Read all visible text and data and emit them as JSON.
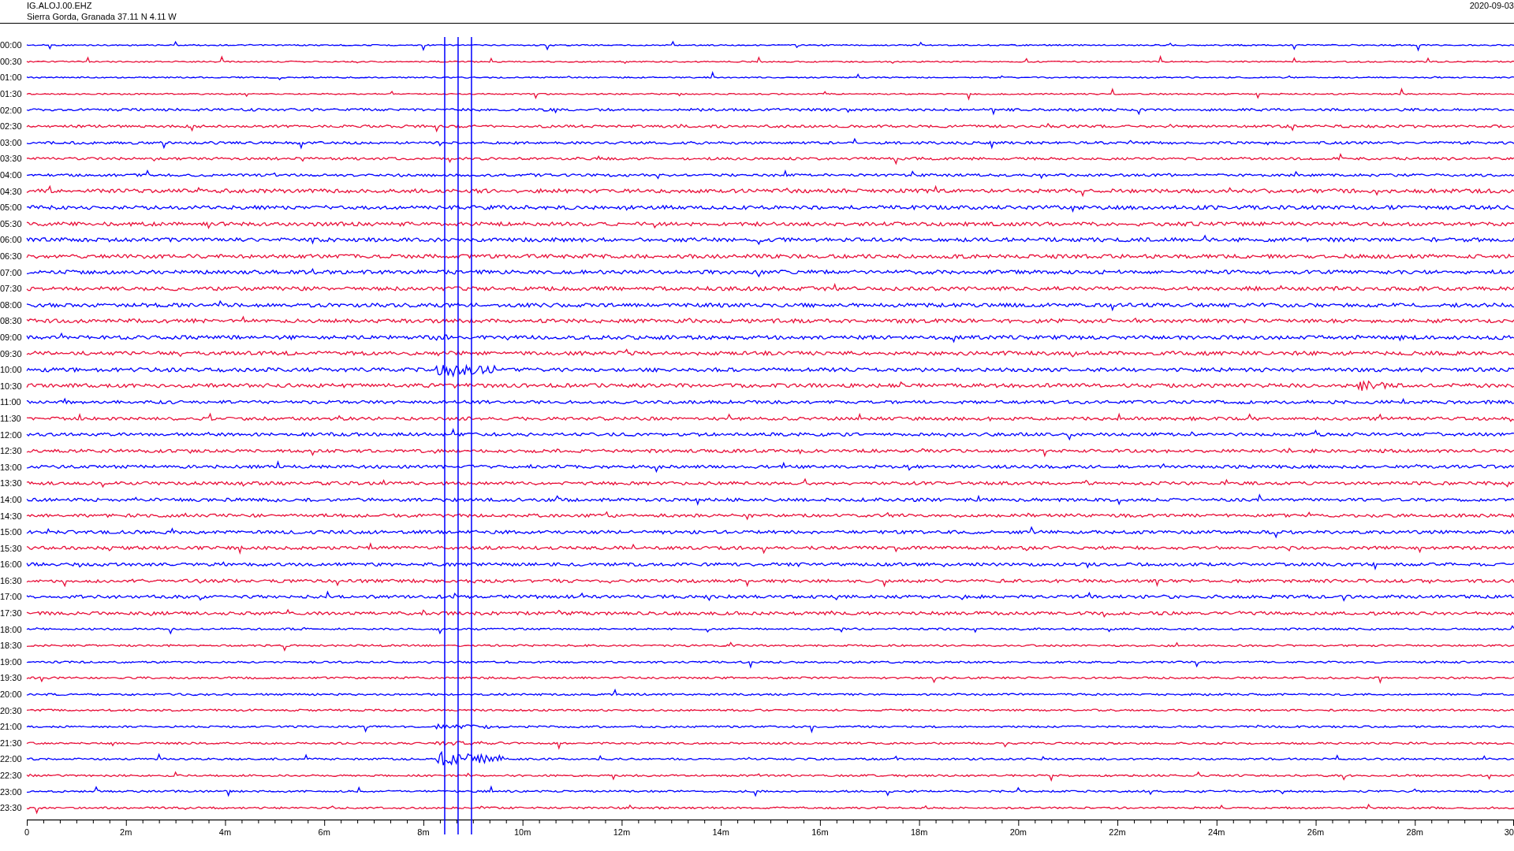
{
  "header": {
    "station": "IG.ALOJ.00.EHZ",
    "location": "Sierra Gorda, Granada  37.11 N 4.11 W",
    "date": "2020-09-03"
  },
  "rows": [
    {
      "label": "00:00",
      "color": "#0000ff"
    },
    {
      "label": "00:30",
      "color": "#e8103a"
    },
    {
      "label": "01:00",
      "color": "#0000ff"
    },
    {
      "label": "01:30",
      "color": "#e8103a"
    },
    {
      "label": "02:00",
      "color": "#0000ff"
    },
    {
      "label": "02:30",
      "color": "#e8103a"
    },
    {
      "label": "03:00",
      "color": "#0000ff"
    },
    {
      "label": "03:30",
      "color": "#e8103a"
    },
    {
      "label": "04:00",
      "color": "#0000ff"
    },
    {
      "label": "04:30",
      "color": "#e8103a"
    },
    {
      "label": "05:00",
      "color": "#0000ff"
    },
    {
      "label": "05:30",
      "color": "#e8103a"
    },
    {
      "label": "06:00",
      "color": "#0000ff"
    },
    {
      "label": "06:30",
      "color": "#e8103a"
    },
    {
      "label": "07:00",
      "color": "#0000ff"
    },
    {
      "label": "07:30",
      "color": "#e8103a"
    },
    {
      "label": "08:00",
      "color": "#0000ff"
    },
    {
      "label": "08:30",
      "color": "#e8103a"
    },
    {
      "label": "09:00",
      "color": "#0000ff"
    },
    {
      "label": "09:30",
      "color": "#e8103a"
    },
    {
      "label": "10:00",
      "color": "#0000ff"
    },
    {
      "label": "10:30",
      "color": "#e8103a"
    },
    {
      "label": "11:00",
      "color": "#0000ff"
    },
    {
      "label": "11:30",
      "color": "#e8103a"
    },
    {
      "label": "12:00",
      "color": "#0000ff"
    },
    {
      "label": "12:30",
      "color": "#e8103a"
    },
    {
      "label": "13:00",
      "color": "#0000ff"
    },
    {
      "label": "13:30",
      "color": "#e8103a"
    },
    {
      "label": "14:00",
      "color": "#0000ff"
    },
    {
      "label": "14:30",
      "color": "#e8103a"
    },
    {
      "label": "15:00",
      "color": "#0000ff"
    },
    {
      "label": "15:30",
      "color": "#e8103a"
    },
    {
      "label": "16:00",
      "color": "#0000ff"
    },
    {
      "label": "16:30",
      "color": "#e8103a"
    },
    {
      "label": "17:00",
      "color": "#0000ff"
    },
    {
      "label": "17:30",
      "color": "#e8103a"
    },
    {
      "label": "18:00",
      "color": "#0000ff"
    },
    {
      "label": "18:30",
      "color": "#e8103a"
    },
    {
      "label": "19:00",
      "color": "#0000ff"
    },
    {
      "label": "19:30",
      "color": "#e8103a"
    },
    {
      "label": "20:00",
      "color": "#0000ff"
    },
    {
      "label": "20:30",
      "color": "#e8103a"
    },
    {
      "label": "21:00",
      "color": "#0000ff"
    },
    {
      "label": "21:30",
      "color": "#e8103a"
    },
    {
      "label": "22:00",
      "color": "#0000ff"
    },
    {
      "label": "22:30",
      "color": "#e8103a"
    },
    {
      "label": "23:00",
      "color": "#0000ff"
    },
    {
      "label": "23:30",
      "color": "#e8103a"
    }
  ],
  "x_axis": {
    "ticks": [
      "0",
      "2m",
      "4m",
      "6m",
      "8m",
      "10m",
      "12m",
      "14m",
      "16m",
      "18m",
      "20m",
      "22m",
      "24m",
      "26m",
      "28m",
      "30"
    ]
  }
}
